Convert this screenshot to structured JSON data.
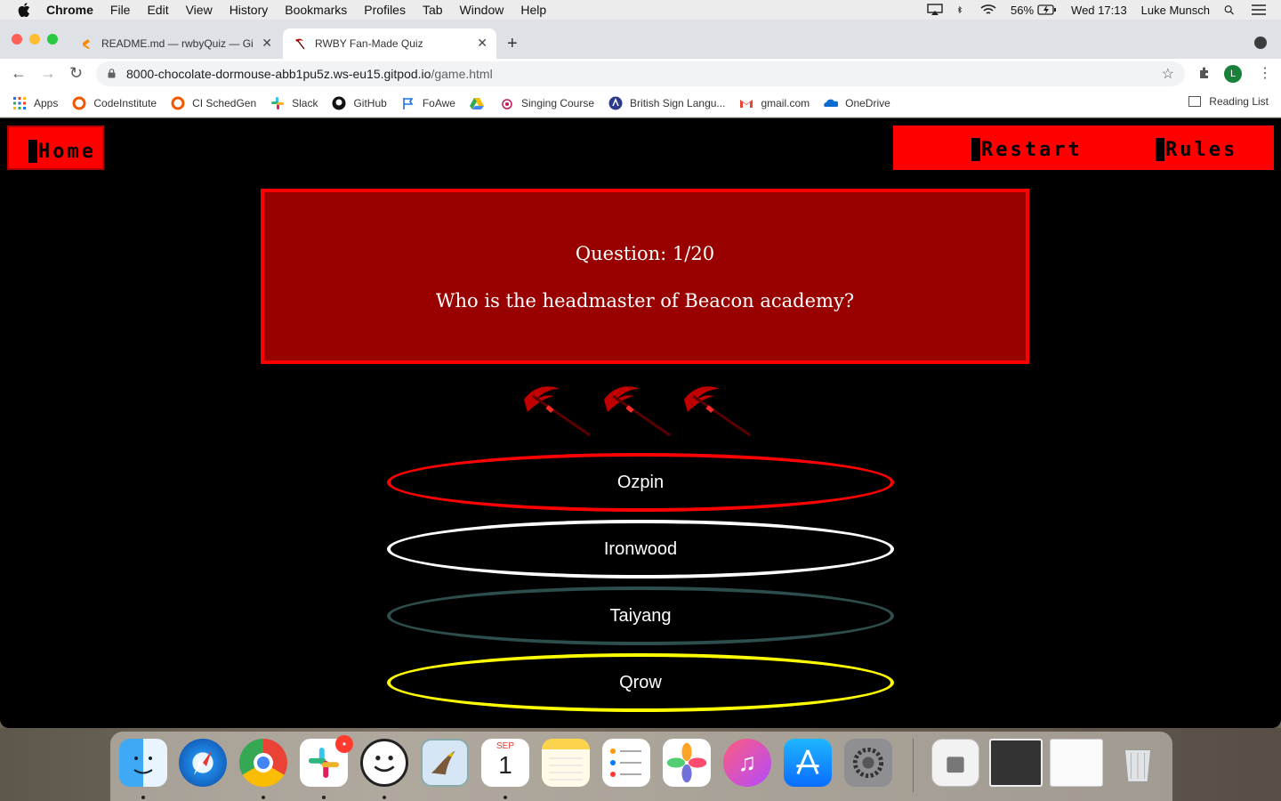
{
  "menubar": {
    "app": "Chrome",
    "items": [
      "File",
      "Edit",
      "View",
      "History",
      "Bookmarks",
      "Profiles",
      "Tab",
      "Window",
      "Help"
    ],
    "battery": "56%",
    "clock": "Wed 17:13",
    "user": "Luke Munsch"
  },
  "tabs": [
    {
      "title": "README.md — rwbyQuiz — Gi",
      "active": false
    },
    {
      "title": "RWBY Fan-Made Quiz",
      "active": true
    }
  ],
  "address": {
    "host": "8000-chocolate-dormouse-abb1pu5z.ws-eu15.gitpod.io",
    "path": "/game.html",
    "profile_initial": "L"
  },
  "bookmarks": [
    {
      "label": "Apps",
      "icon": "apps-grid-icon"
    },
    {
      "label": "CodeInstitute",
      "icon": "codeinstitute-icon"
    },
    {
      "label": "CI SchedGen",
      "icon": "codeinstitute-icon"
    },
    {
      "label": "Slack",
      "icon": "slack-icon"
    },
    {
      "label": "GitHub",
      "icon": "github-icon"
    },
    {
      "label": "FoAwe",
      "icon": "flag-icon"
    },
    {
      "label": "",
      "icon": "google-drive-icon"
    },
    {
      "label": "Singing Course",
      "icon": "singing-icon"
    },
    {
      "label": "British Sign Langu...",
      "icon": "bsl-icon"
    },
    {
      "label": "gmail.com",
      "icon": "gmail-icon"
    },
    {
      "label": "OneDrive",
      "icon": "onedrive-icon"
    }
  ],
  "reading_list": "Reading List",
  "page": {
    "nav": {
      "home": "Home",
      "restart": "Restart",
      "rules": "Rules"
    },
    "question": {
      "counter": "Question: 1/20",
      "text": "Who is the headmaster of Beacon academy?"
    },
    "lives_remaining": 3,
    "answers": [
      {
        "label": "Ozpin",
        "color": "#ff0000"
      },
      {
        "label": "Ironwood",
        "color": "#ffffff"
      },
      {
        "label": "Taiyang",
        "color": "#2e4d4d"
      },
      {
        "label": "Qrow",
        "color": "#ffff00"
      }
    ],
    "colors": {
      "accent": "#ff0000",
      "question_bg": "#990000",
      "background": "#000000"
    }
  },
  "dock": {
    "calendar_month": "SEP",
    "calendar_day": "1",
    "slack_badge": "•",
    "apps": [
      "finder-icon",
      "safari-icon",
      "chrome-icon",
      "slack-icon",
      "face-icon",
      "mail-icon",
      "calendar-icon",
      "notes-icon",
      "reminders-icon",
      "photos-icon",
      "music-icon",
      "app-store-icon",
      "system-preferences-icon",
      "downloads-icon",
      "screenshot-icon",
      "screenshot-icon",
      "trash-icon"
    ]
  }
}
